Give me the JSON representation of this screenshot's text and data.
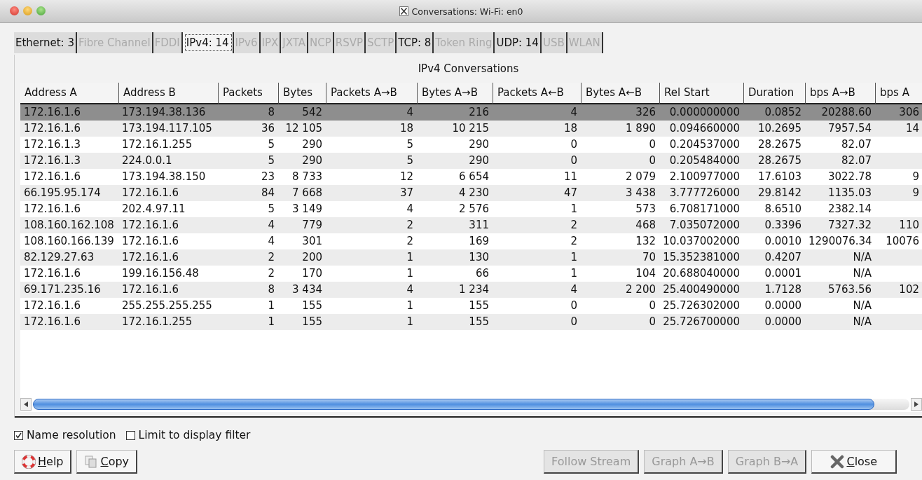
{
  "window": {
    "title": "Conversations: Wi-Fi: en0"
  },
  "tabs": [
    {
      "label": "Ethernet: 3",
      "selected": false,
      "disabled": false
    },
    {
      "label": "Fibre Channel",
      "selected": false,
      "disabled": true
    },
    {
      "label": "FDDI",
      "selected": false,
      "disabled": true
    },
    {
      "label": "IPv4: 14",
      "selected": true,
      "disabled": false
    },
    {
      "label": "IPv6",
      "selected": false,
      "disabled": true
    },
    {
      "label": "IPX",
      "selected": false,
      "disabled": true
    },
    {
      "label": "JXTA",
      "selected": false,
      "disabled": true
    },
    {
      "label": "NCP",
      "selected": false,
      "disabled": true
    },
    {
      "label": "RSVP",
      "selected": false,
      "disabled": true
    },
    {
      "label": "SCTP",
      "selected": false,
      "disabled": true
    },
    {
      "label": "TCP: 8",
      "selected": false,
      "disabled": false
    },
    {
      "label": "Token Ring",
      "selected": false,
      "disabled": true
    },
    {
      "label": "UDP: 14",
      "selected": false,
      "disabled": false
    },
    {
      "label": "USB",
      "selected": false,
      "disabled": true
    },
    {
      "label": "WLAN",
      "selected": false,
      "disabled": true
    }
  ],
  "table": {
    "title": "IPv4 Conversations",
    "columns": [
      "Address A",
      "Address B",
      "Packets",
      "Bytes",
      "Packets A→B",
      "Bytes A→B",
      "Packets A←B",
      "Bytes A←B",
      "Rel Start",
      "Duration",
      "bps A→B",
      "bps A"
    ],
    "rows": [
      {
        "selected": true,
        "cells": [
          "172.16.1.6",
          "173.194.38.136",
          "8",
          "542",
          "4",
          "216",
          "4",
          "326",
          "0.000000000",
          "0.0852",
          "20288.60",
          "306"
        ]
      },
      {
        "selected": false,
        "cells": [
          "172.16.1.6",
          "173.194.117.105",
          "36",
          "12 105",
          "18",
          "10 215",
          "18",
          "1 890",
          "0.094660000",
          "10.2695",
          "7957.54",
          "14"
        ]
      },
      {
        "selected": false,
        "cells": [
          "172.16.1.3",
          "172.16.1.255",
          "5",
          "290",
          "5",
          "290",
          "0",
          "0",
          "0.204537000",
          "28.2675",
          "82.07",
          ""
        ]
      },
      {
        "selected": false,
        "cells": [
          "172.16.1.3",
          "224.0.0.1",
          "5",
          "290",
          "5",
          "290",
          "0",
          "0",
          "0.205484000",
          "28.2675",
          "82.07",
          ""
        ]
      },
      {
        "selected": false,
        "cells": [
          "172.16.1.6",
          "173.194.38.150",
          "23",
          "8 733",
          "12",
          "6 654",
          "11",
          "2 079",
          "2.100977000",
          "17.6103",
          "3022.78",
          "9"
        ]
      },
      {
        "selected": false,
        "cells": [
          "66.195.95.174",
          "172.16.1.6",
          "84",
          "7 668",
          "37",
          "4 230",
          "47",
          "3 438",
          "3.777726000",
          "29.8142",
          "1135.03",
          "9"
        ]
      },
      {
        "selected": false,
        "cells": [
          "172.16.1.6",
          "202.4.97.11",
          "5",
          "3 149",
          "4",
          "2 576",
          "1",
          "573",
          "6.708171000",
          "8.6510",
          "2382.14",
          ""
        ]
      },
      {
        "selected": false,
        "cells": [
          "108.160.162.108",
          "172.16.1.6",
          "4",
          "779",
          "2",
          "311",
          "2",
          "468",
          "7.035072000",
          "0.3396",
          "7327.32",
          "110"
        ]
      },
      {
        "selected": false,
        "cells": [
          "108.160.166.139",
          "172.16.1.6",
          "4",
          "301",
          "2",
          "169",
          "2",
          "132",
          "10.037002000",
          "0.0010",
          "1290076.34",
          "10076"
        ]
      },
      {
        "selected": false,
        "cells": [
          "82.129.27.63",
          "172.16.1.6",
          "2",
          "200",
          "1",
          "130",
          "1",
          "70",
          "15.352381000",
          "0.4207",
          "N/A",
          ""
        ]
      },
      {
        "selected": false,
        "cells": [
          "172.16.1.6",
          "199.16.156.48",
          "2",
          "170",
          "1",
          "66",
          "1",
          "104",
          "20.688040000",
          "0.0001",
          "N/A",
          ""
        ]
      },
      {
        "selected": false,
        "cells": [
          "69.171.235.16",
          "172.16.1.6",
          "8",
          "3 434",
          "4",
          "1 234",
          "4",
          "2 200",
          "25.400490000",
          "1.7128",
          "5763.56",
          "102"
        ]
      },
      {
        "selected": false,
        "cells": [
          "172.16.1.6",
          "255.255.255.255",
          "1",
          "155",
          "1",
          "155",
          "0",
          "0",
          "25.726302000",
          "0.0000",
          "N/A",
          ""
        ]
      },
      {
        "selected": false,
        "cells": [
          "172.16.1.6",
          "172.16.1.255",
          "1",
          "155",
          "1",
          "155",
          "0",
          "0",
          "25.726700000",
          "0.0000",
          "N/A",
          ""
        ]
      }
    ]
  },
  "options": [
    {
      "label": "Name resolution",
      "checked": true
    },
    {
      "label": "Limit to display filter",
      "checked": false
    }
  ],
  "buttons": [
    {
      "kind": "help",
      "label": "Help",
      "disabled": false
    },
    {
      "kind": "copy",
      "label": "Copy",
      "disabled": false
    },
    {
      "kind": "plain",
      "label": "Follow Stream",
      "disabled": true
    },
    {
      "kind": "plain",
      "label": "Graph A→B",
      "disabled": true
    },
    {
      "kind": "plain",
      "label": "Graph B→A",
      "disabled": true
    },
    {
      "kind": "close",
      "label": "Close",
      "disabled": false
    }
  ]
}
